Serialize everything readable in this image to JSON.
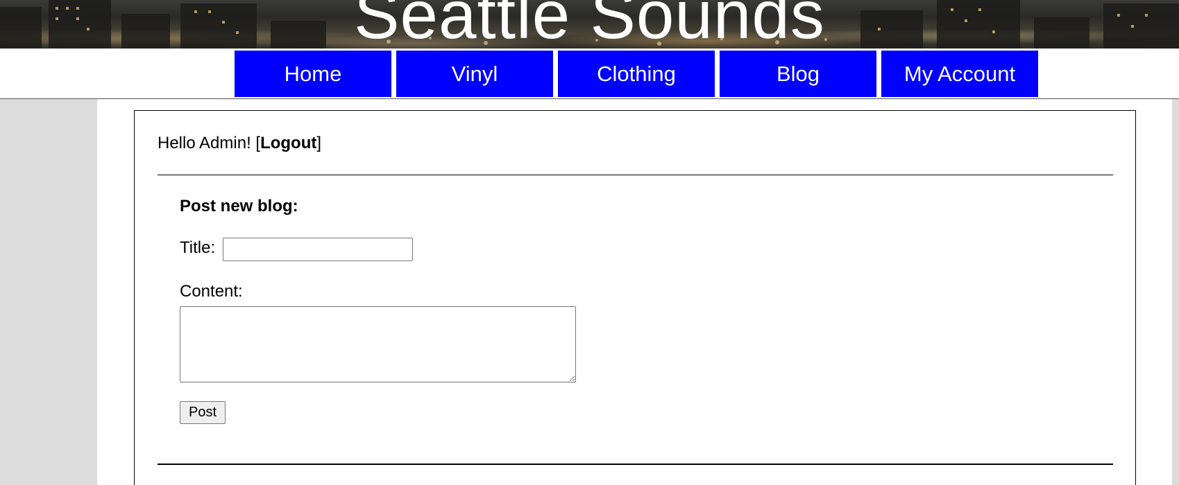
{
  "site": {
    "title": "Seattle Sounds"
  },
  "nav": {
    "items": [
      {
        "label": "Home"
      },
      {
        "label": "Vinyl"
      },
      {
        "label": "Clothing"
      },
      {
        "label": "Blog"
      },
      {
        "label": "My Account"
      }
    ],
    "color": "#0000ff"
  },
  "account": {
    "greeting": "Hello Admin! [",
    "logout_label": "Logout",
    "greeting_end": "]"
  },
  "blog_form": {
    "heading": "Post new blog:",
    "title_label": "Title:",
    "title_value": "",
    "content_label": "Content:",
    "content_value": "",
    "post_label": "Post"
  },
  "colors": {
    "page_bg": "#dcdcdc",
    "nav_bg": "#0000ff",
    "nav_text": "#ffffff"
  }
}
